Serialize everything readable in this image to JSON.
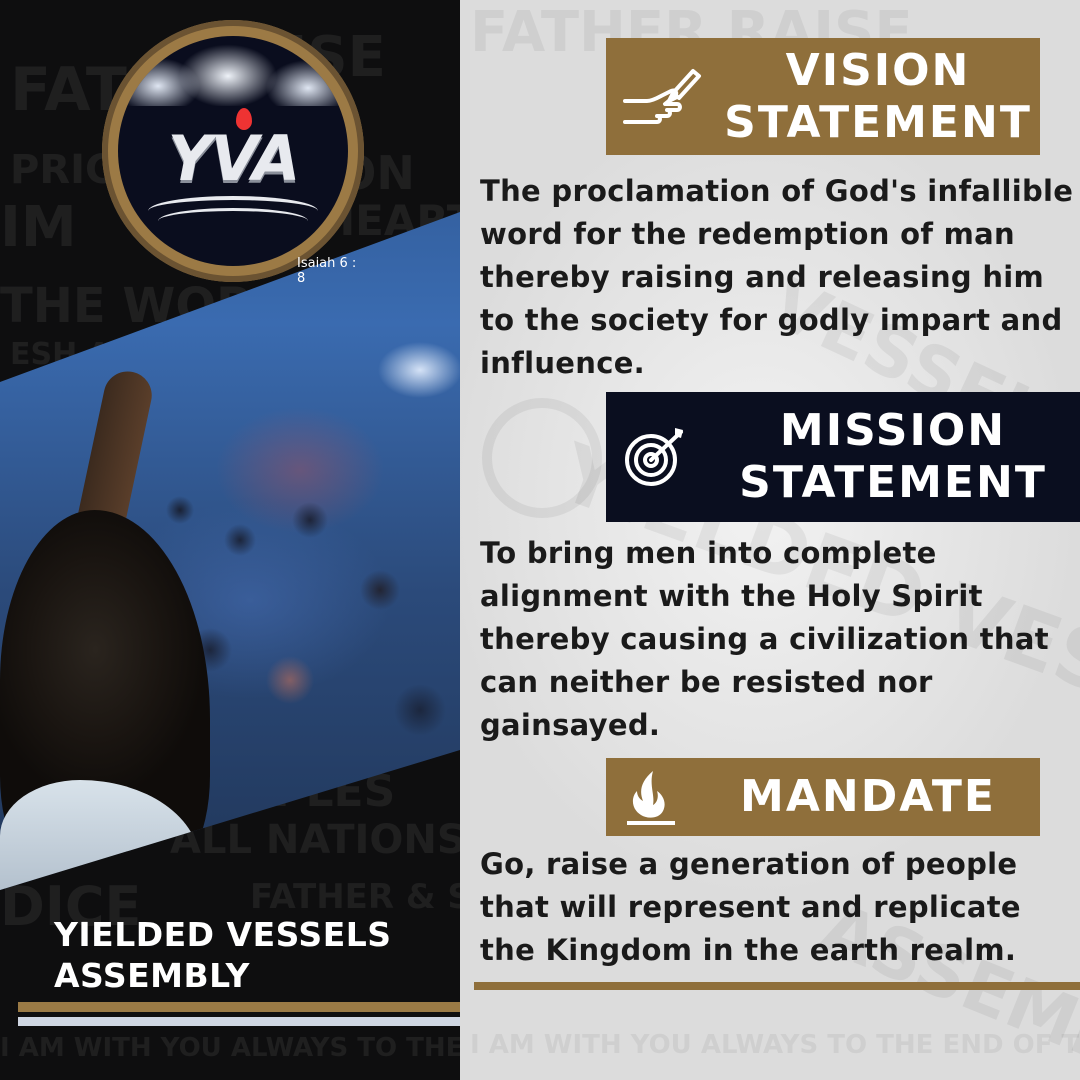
{
  "brand": {
    "logo_text": "YVA",
    "logo_caption": "Isaiah 6 : 8",
    "org_name_line1": "YIELDED VESSELS",
    "org_name_line2": "ASSEMBLY"
  },
  "sections": {
    "vision": {
      "title_line1": "VISION",
      "title_line2": "STATEMENT",
      "icon": "hand-writing-icon",
      "text": "The proclamation of God's infallible word for the redemption of man thereby raising and releasing him to the society for godly impart and influence."
    },
    "mission": {
      "title_line1": "MISSION",
      "title_line2": "STATEMENT",
      "icon": "target-icon",
      "text": "To bring men into complete alignment with the Holy Spirit thereby causing a civilization that can neither be resisted nor gainsayed."
    },
    "mandate": {
      "title": "MANDATE",
      "icon": "flame-icon",
      "text": "Go, raise a generation of people that will represent and replicate the Kingdom in the earth realm."
    }
  },
  "colors": {
    "gold": "#8f6f3b",
    "navy": "#0a0e1f",
    "dark_bg": "#0e0e0f"
  }
}
